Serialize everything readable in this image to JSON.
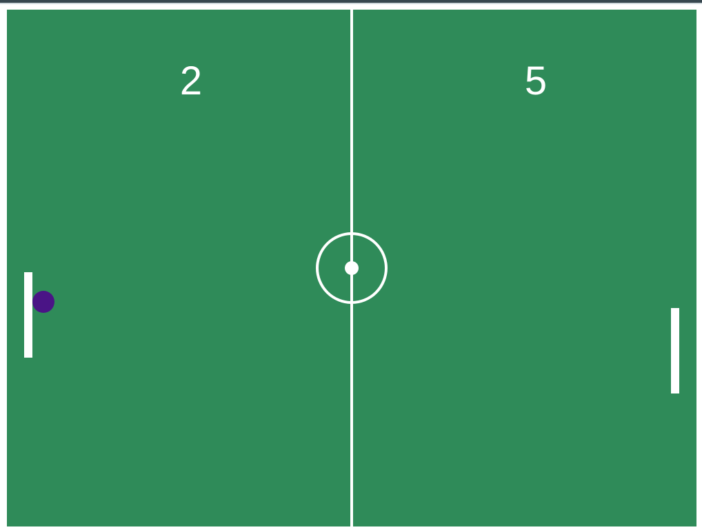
{
  "game": {
    "score_left": "2",
    "score_right": "5"
  },
  "colors": {
    "field": "#2f8b59",
    "lines": "#ffffff",
    "ball": "#4a1486",
    "window_strip": "#37474f"
  },
  "icons": {
    "ball": "ball-icon",
    "center_spot": "center-dot-icon"
  }
}
